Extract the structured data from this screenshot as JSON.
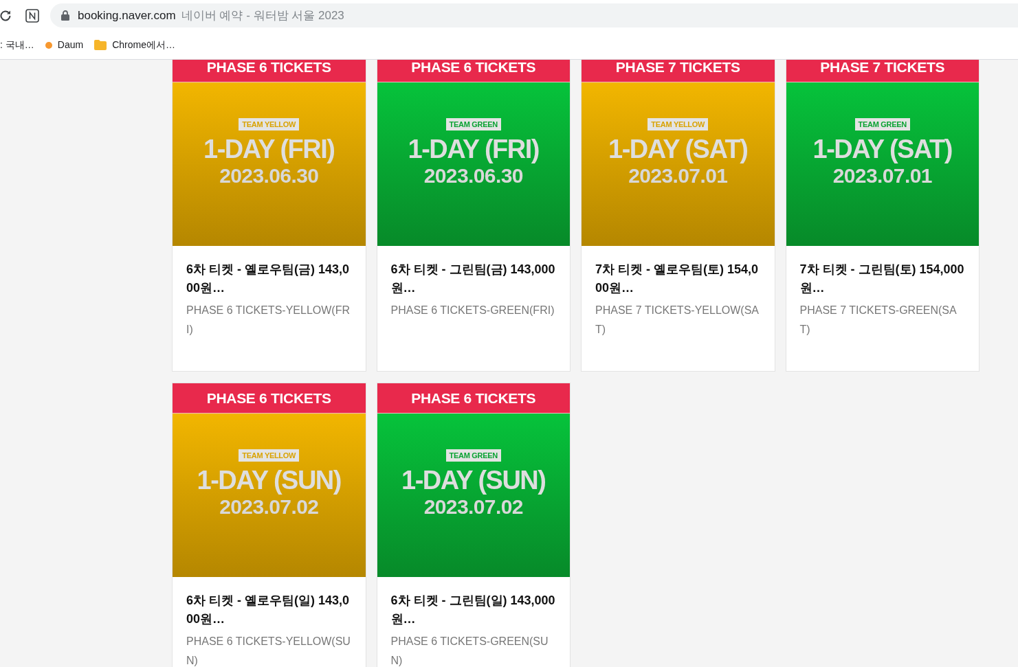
{
  "browser": {
    "url": "booking.naver.com",
    "page_title": "네이버 예약 - 워터밤 서울 2023"
  },
  "bookmarks": [
    {
      "kind": "text",
      "label": ": 국내…"
    },
    {
      "kind": "site",
      "label": "Daum"
    },
    {
      "kind": "folder",
      "label": "Chrome에서…"
    }
  ],
  "products": [
    {
      "header": "PHASE 6 TICKETS",
      "kind": "yellow",
      "team": "TEAM YELLOW",
      "day": "1-DAY (FRI)",
      "date": "2023.06.30",
      "title": "6차 티켓 - 옐로우팀(금) 143,000원…",
      "subtitle": "PHASE 6 TICKETS-YELLOW(FRI)"
    },
    {
      "header": "PHASE 6 TICKETS",
      "kind": "green",
      "team": "TEAM GREEN",
      "day": "1-DAY (FRI)",
      "date": "2023.06.30",
      "title": "6차 티켓 - 그린팀(금) 143,000원…",
      "subtitle": "PHASE 6 TICKETS-GREEN(FRI)"
    },
    {
      "header": "PHASE 7 TICKETS",
      "kind": "yellow",
      "team": "TEAM YELLOW",
      "day": "1-DAY (SAT)",
      "date": "2023.07.01",
      "title": "7차 티켓 - 옐로우팀(토) 154,000원…",
      "subtitle": "PHASE 7 TICKETS-YELLOW(SAT)"
    },
    {
      "header": "PHASE 7 TICKETS",
      "kind": "green",
      "team": "TEAM GREEN",
      "day": "1-DAY (SAT)",
      "date": "2023.07.01",
      "title": "7차 티켓 - 그린팀(토) 154,000원…",
      "subtitle": "PHASE 7 TICKETS-GREEN(SAT)"
    },
    {
      "header": "PHASE 6 TICKETS",
      "kind": "yellow",
      "team": "TEAM YELLOW",
      "day": "1-DAY (SUN)",
      "date": "2023.07.02",
      "title": "6차 티켓 - 옐로우팀(일) 143,000원…",
      "subtitle": "PHASE 6 TICKETS-YELLOW(SUN)"
    },
    {
      "header": "PHASE 6 TICKETS",
      "kind": "green",
      "team": "TEAM GREEN",
      "day": "1-DAY (SUN)",
      "date": "2023.07.02",
      "title": "6차 티켓 - 그린팀(일) 143,000원…",
      "subtitle": "PHASE 6 TICKETS-GREEN(SUN)"
    }
  ]
}
